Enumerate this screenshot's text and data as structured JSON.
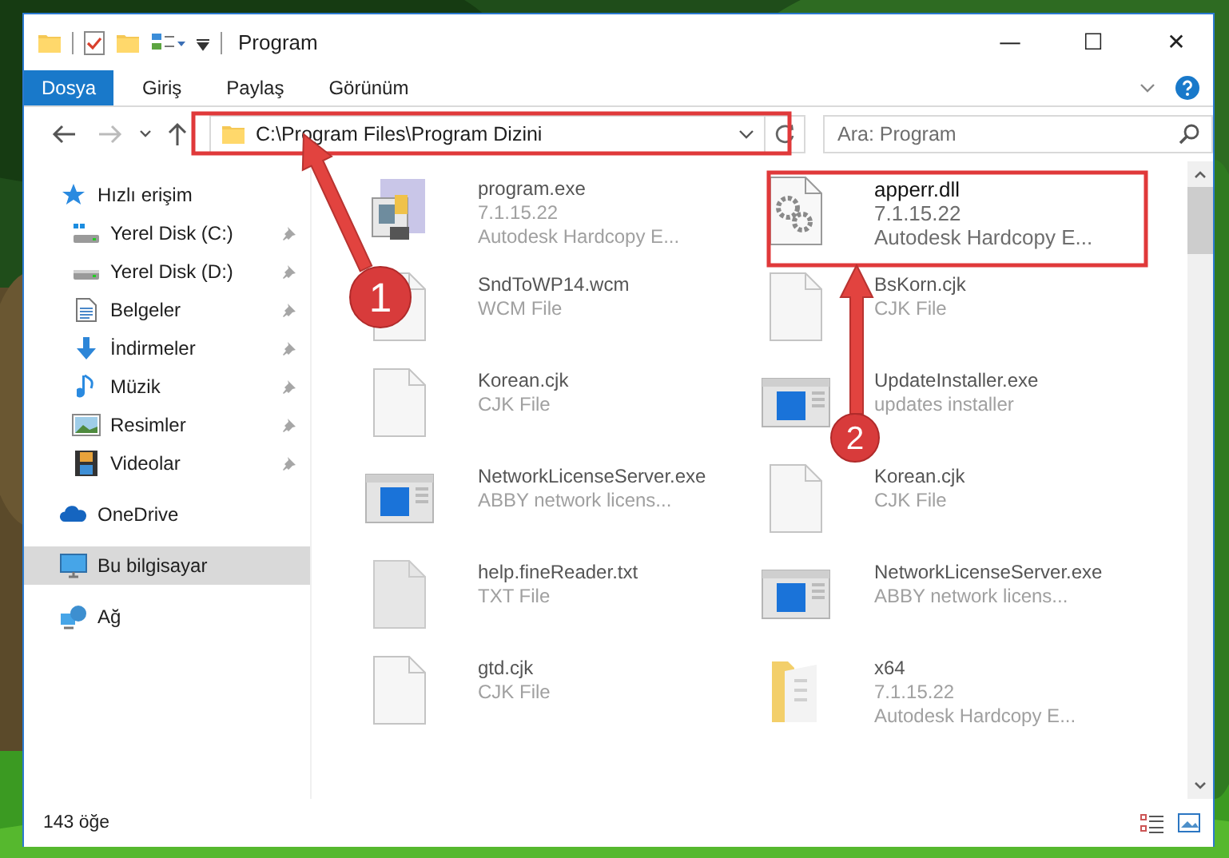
{
  "window": {
    "title": "Program",
    "controls": [
      "—",
      "☐",
      "✕"
    ]
  },
  "ribbon": {
    "tabs": [
      {
        "label": "Dosya",
        "kind": "file"
      },
      {
        "label": "Giriş",
        "kind": "tab"
      },
      {
        "label": "Paylaş",
        "kind": "tab"
      },
      {
        "label": "Görünüm",
        "kind": "tab"
      }
    ]
  },
  "address": {
    "path": "C:\\Program Files\\Program Dizini"
  },
  "search": {
    "placeholder": "Ara: Program"
  },
  "sidebar": {
    "items": [
      {
        "label": "Hızlı erişim",
        "kind": "quick",
        "selected": false,
        "children": [
          {
            "label": "Yerel Disk (C:)",
            "kind": "drive-c",
            "pinned": true,
            "selected": false
          },
          {
            "label": "Yerel Disk (D:)",
            "kind": "drive",
            "pinned": true,
            "selected": false
          },
          {
            "label": "Belgeler",
            "kind": "documents",
            "pinned": true,
            "selected": false
          },
          {
            "label": "İndirmeler",
            "kind": "downloads",
            "pinned": true,
            "selected": false
          },
          {
            "label": "Müzik",
            "kind": "music",
            "pinned": true,
            "selected": false
          },
          {
            "label": "Resimler",
            "kind": "pictures",
            "pinned": true,
            "selected": false
          },
          {
            "label": "Videolar",
            "kind": "videos",
            "pinned": true,
            "selected": false
          }
        ]
      },
      {
        "label": "OneDrive",
        "kind": "cloud",
        "selected": false
      },
      {
        "label": "Bu bilgisayar",
        "kind": "computer",
        "selected": true
      },
      {
        "label": "Ağ",
        "kind": "network",
        "selected": false
      }
    ]
  },
  "files": [
    {
      "name": "program.exe",
      "details": [
        "7.1.15.22",
        "Autodesk Hardcopy E..."
      ],
      "kind": "app",
      "highlighted": false
    },
    {
      "name": "apperr.dll",
      "details": [
        "7.1.15.22",
        "Autodesk Hardcopy E..."
      ],
      "kind": "dll",
      "highlighted": true
    },
    {
      "name": "SndToWP14.wcm",
      "details": [
        "WCM File"
      ],
      "kind": "blank",
      "highlighted": false
    },
    {
      "name": "BsKorn.cjk",
      "details": [
        "CJK File"
      ],
      "kind": "blank",
      "highlighted": false
    },
    {
      "name": "Korean.cjk",
      "details": [
        "CJK File"
      ],
      "kind": "blank",
      "highlighted": false
    },
    {
      "name": "UpdateInstaller.exe",
      "details": [
        "updates installer"
      ],
      "kind": "window",
      "highlighted": false
    },
    {
      "name": "NetworkLicenseServer.exe",
      "details": [
        "ABBY network licens..."
      ],
      "kind": "window",
      "highlighted": false
    },
    {
      "name": "Korean.cjk",
      "details": [
        "CJK File"
      ],
      "kind": "blank",
      "highlighted": false
    },
    {
      "name": "help.fineReader.txt",
      "details": [
        "TXT File"
      ],
      "kind": "text",
      "highlighted": false
    },
    {
      "name": "NetworkLicenseServer.exe",
      "details": [
        "ABBY network licens..."
      ],
      "kind": "window",
      "highlighted": false
    },
    {
      "name": "gtd.cjk",
      "details": [
        "CJK File"
      ],
      "kind": "blank",
      "highlighted": false
    },
    {
      "name": "x64",
      "details": [
        "7.1.15.22",
        "Autodesk Hardcopy E..."
      ],
      "kind": "folder",
      "highlighted": false
    }
  ],
  "status_bar": {
    "count": "143 öğe"
  },
  "annotations": [
    {
      "number": "1"
    },
    {
      "number": "2"
    }
  ]
}
